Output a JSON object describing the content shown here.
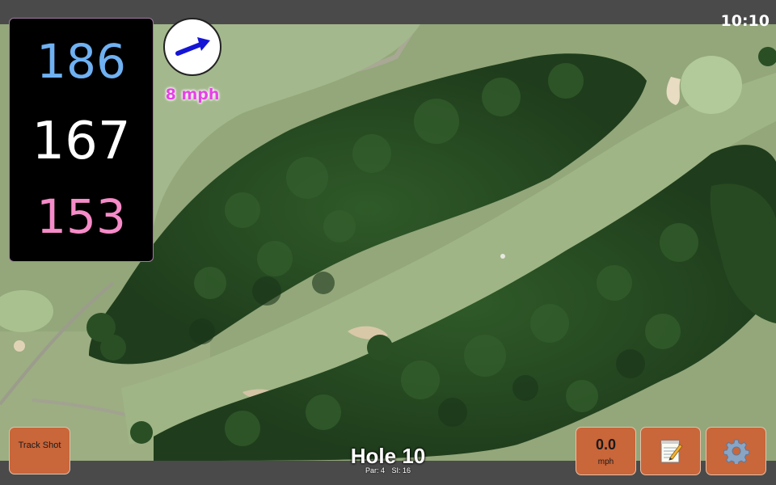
{
  "status_bar": {
    "time": "10:10"
  },
  "distances": {
    "back": "186",
    "middle": "167",
    "front": "153"
  },
  "wind": {
    "speed_label": "8 mph",
    "icon": "wind-direction-arrow-icon"
  },
  "hole": {
    "title": "Hole 10",
    "par": "Par: 4",
    "stroke_index": "SI: 16"
  },
  "buttons": {
    "track_shot": "Track Shot",
    "speed_value": "0.0",
    "speed_unit": "mph",
    "notes_icon": "notepad-icon",
    "settings_icon": "gear-icon"
  },
  "colors": {
    "back": "#6fb1f2",
    "middle": "#ffffff",
    "front": "#f58bc8",
    "button": "#c9663a",
    "wind_text": "#e642e6"
  }
}
